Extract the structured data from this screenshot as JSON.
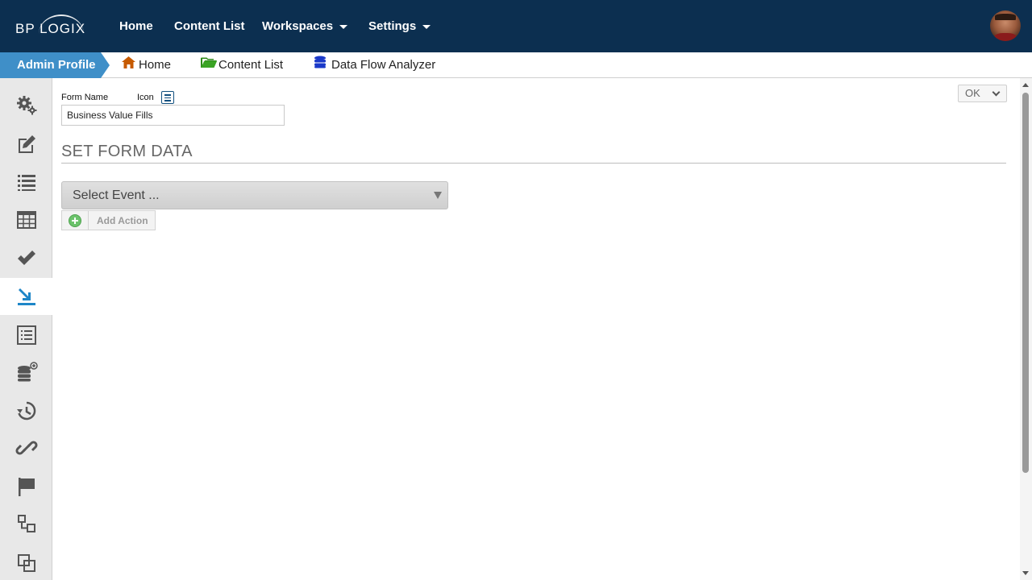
{
  "topnav": {
    "logo_text": "BP LOGIX",
    "items": [
      {
        "label": "Home"
      },
      {
        "label": "Content List"
      },
      {
        "label": "Workspaces"
      },
      {
        "label": "Settings"
      }
    ],
    "bg_color": "#0c2f50"
  },
  "breadcrumbs": {
    "current": "Admin Profile",
    "items": [
      {
        "label": "Home",
        "icon": "house-icon",
        "color": "#c65a00"
      },
      {
        "label": "Content List",
        "icon": "folder-open-icon",
        "color": "#2e8b1a"
      },
      {
        "label": "Data Flow Analyzer",
        "icon": "database-icon",
        "color": "#1a39c9"
      }
    ]
  },
  "sidebar": {
    "items": [
      {
        "icon": "gears-icon"
      },
      {
        "icon": "edit-icon"
      },
      {
        "icon": "list-icon"
      },
      {
        "icon": "table-icon"
      },
      {
        "icon": "checkmark-icon"
      },
      {
        "icon": "data-fill-icon",
        "active": true
      },
      {
        "icon": "form-list-icon"
      },
      {
        "icon": "database-add-icon"
      },
      {
        "icon": "history-icon"
      },
      {
        "icon": "link-icon"
      },
      {
        "icon": "flag-icon"
      },
      {
        "icon": "hierarchy-icon"
      },
      {
        "icon": "copy-icon"
      }
    ]
  },
  "form": {
    "name_label": "Form Name",
    "icon_label": "Icon",
    "name_value": "Business Value Fills",
    "ok_label": "OK",
    "section_title": "SET FORM DATA",
    "event_select_value": "Select Event ...",
    "add_action_label": "Add Action"
  }
}
